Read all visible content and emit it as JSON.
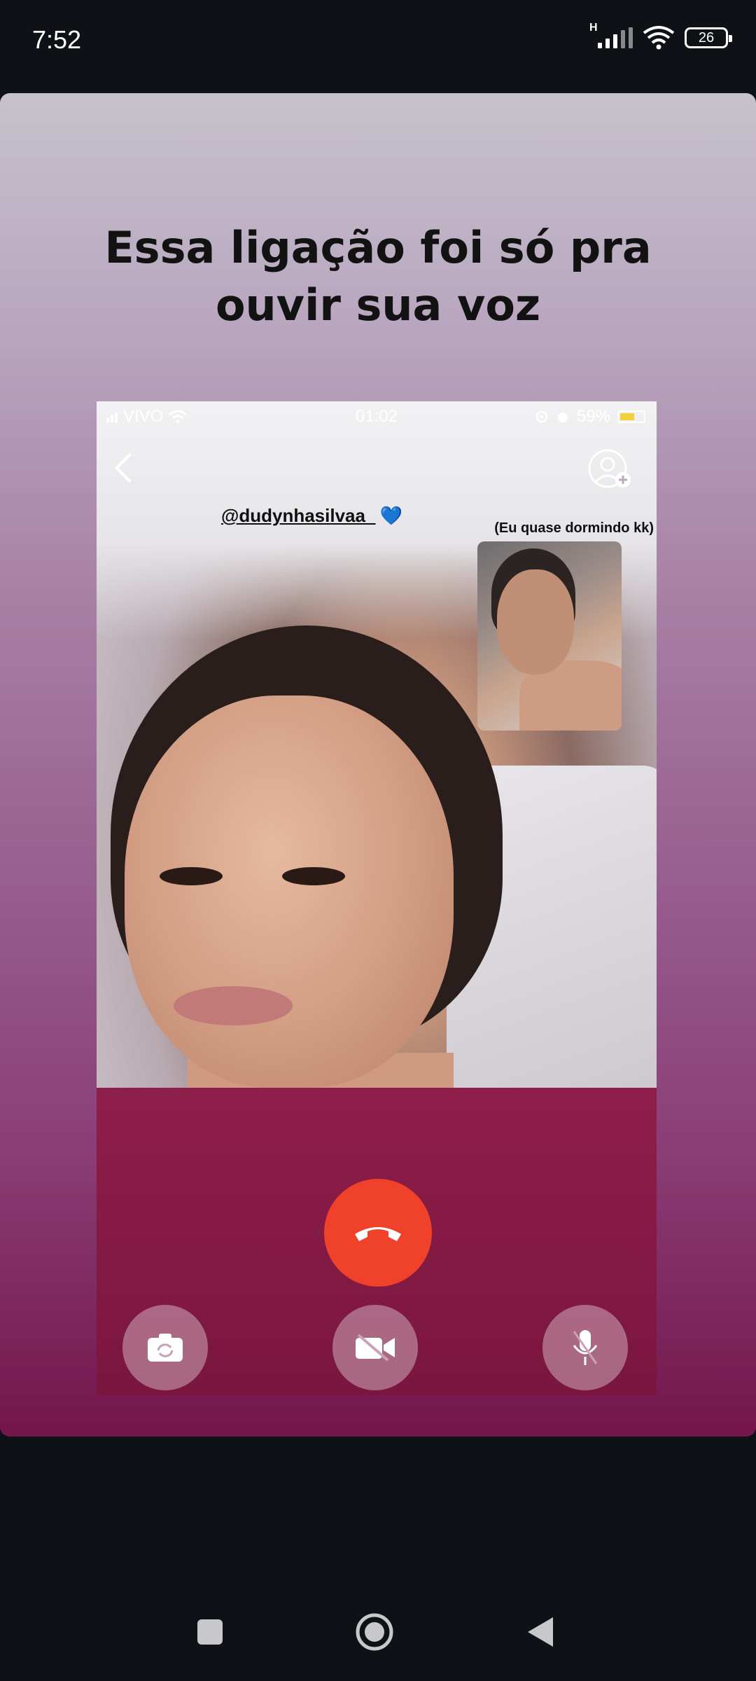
{
  "status_bar": {
    "time": "7:52",
    "network_type": "H",
    "battery_level": "26",
    "icons": [
      "signal-icon",
      "wifi-icon",
      "battery-icon"
    ]
  },
  "story": {
    "caption_line1": "Essa ligação foi só pra",
    "caption_line2": "ouvir sua voz",
    "call_screenshot": {
      "carrier": "VIVO",
      "time": "01:02",
      "battery": "59%",
      "username_tag": "@dudynhasilvaa_",
      "heart_emoji": "💙",
      "pip_caption": "(Eu quase dormindo kk)",
      "controls": [
        "switch-camera-icon",
        "video-off-icon",
        "mute-mic-icon"
      ],
      "end_call_color": "#f0412a"
    }
  },
  "navigation": {
    "buttons": [
      "recents-button",
      "home-button",
      "back-button"
    ]
  },
  "colors": {
    "gradient_top": "#c6c2cb",
    "gradient_bottom": "#74154c",
    "end_call": "#f0412a",
    "shirt": "#8e1e4a"
  }
}
